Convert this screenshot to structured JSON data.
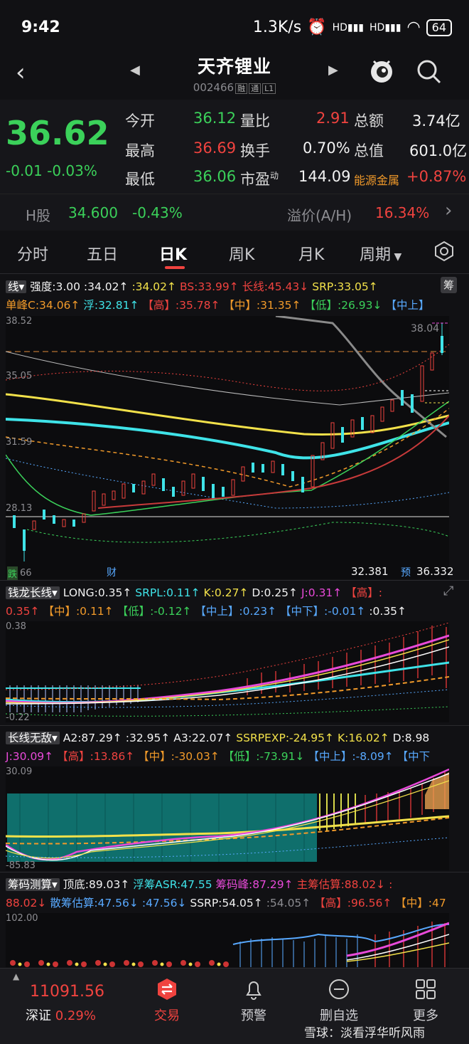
{
  "status": {
    "time": "9:42",
    "speed": "1.3K/s",
    "battery": "64"
  },
  "header": {
    "title": "天齐锂业",
    "code": "002466",
    "tags": [
      "融",
      "通",
      "L1"
    ]
  },
  "quote": {
    "price": "36.62",
    "change": "-0.01",
    "change_pct": "-0.03%",
    "rows": [
      {
        "l1": "今开",
        "v1": "36.12",
        "l2": "量比",
        "v2": "2.91",
        "l3": "总额",
        "v3": "3.74亿"
      },
      {
        "l1": "最高",
        "v1": "36.69",
        "l2": "换手",
        "v2": "0.70%",
        "l3": "总值",
        "v3": "601.0亿"
      },
      {
        "l1": "最低",
        "v1": "36.06",
        "l2": "市盈",
        "l2sup": "动",
        "v2": "144.09",
        "l3": "能源金属",
        "v3": "+0.87%"
      }
    ]
  },
  "hshare": {
    "label": "H股",
    "price": "34.600",
    "pct": "-0.43%",
    "premium_label": "溢价(A/H)",
    "premium": "16.34%"
  },
  "tabs": [
    "分时",
    "五日",
    "日K",
    "周K",
    "月K",
    "周期"
  ],
  "main_chart": {
    "indicator": "线",
    "row1": [
      "强度:3.00",
      ":34.02↑",
      ":34.02↑",
      "BS:33.99↑",
      "长线:45.43↓",
      "SRP:33.05↑"
    ],
    "row1_right": "筹",
    "row2": [
      "单峰C:34.06↑",
      "浮:32.81↑",
      "【高】:35.78↑",
      "【中】:31.35↑",
      "【低】:26.93↓",
      "【中上】"
    ],
    "y_labels": [
      "38.52",
      "35.05",
      "31.59",
      "28.13"
    ],
    "top_label": "38.04",
    "bottom_left": "跌",
    "bottom_left2": "66",
    "bottom_mid": "财",
    "bottom_val": "32.381",
    "bottom_tag": "预",
    "bottom_val2": "36.332"
  },
  "panel2": {
    "name": "钱龙长线",
    "row1": [
      "LONG:0.35↑",
      "SRPL:0.11↑",
      "K:0.27↑",
      "D:0.25↑",
      "J:0.31↑",
      "【高】:"
    ],
    "row2": [
      "0.35↑",
      "【中】:0.11↑",
      "【低】:-0.12↑",
      "【中上】:0.23↑",
      "【中下】:-0.01↑",
      ":0.35↑"
    ],
    "y_top": "0.38",
    "y_bottom": "-0.22"
  },
  "panel3": {
    "name": "长线无敌",
    "row1": [
      "A2:87.29↑",
      ":32.95↑",
      "A3:22.07↑",
      "SSRPEXP:-24.95↑",
      "K:16.02↑",
      "D:8.98"
    ],
    "row2": [
      "J:30.09↑",
      "【高】:13.86↑",
      "【中】:-30.03↑",
      "【低】:-73.91↓",
      "【中上】:-8.09↑",
      "【中下"
    ],
    "y_top": "30.09",
    "y_bottom": "-85.83"
  },
  "panel4": {
    "name": "筹码测算",
    "row1": [
      "顶底:89.03↑",
      "浮筹ASR:47.55",
      "筹码峰:87.29↑",
      "主筹估算:88.02↓",
      ":"
    ],
    "row2": [
      "88.02↓",
      "散筹估算:47.56↓",
      ":47.56↓",
      "SSRP:54.05↑",
      ":54.05↑",
      "【高】:96.56↑",
      "【中】:47"
    ],
    "y_top": "102.00"
  },
  "bottom_nav": {
    "index_value": "11091.56",
    "index_name": "深证",
    "index_pct": "0.29%",
    "items": [
      "交易",
      "预警",
      "删自选",
      "更多"
    ],
    "watermark": "雪球：淡看浮华听风雨"
  },
  "colors": {
    "up": "#f0433f",
    "down": "#3bd15a",
    "accent": "#f0433f"
  }
}
